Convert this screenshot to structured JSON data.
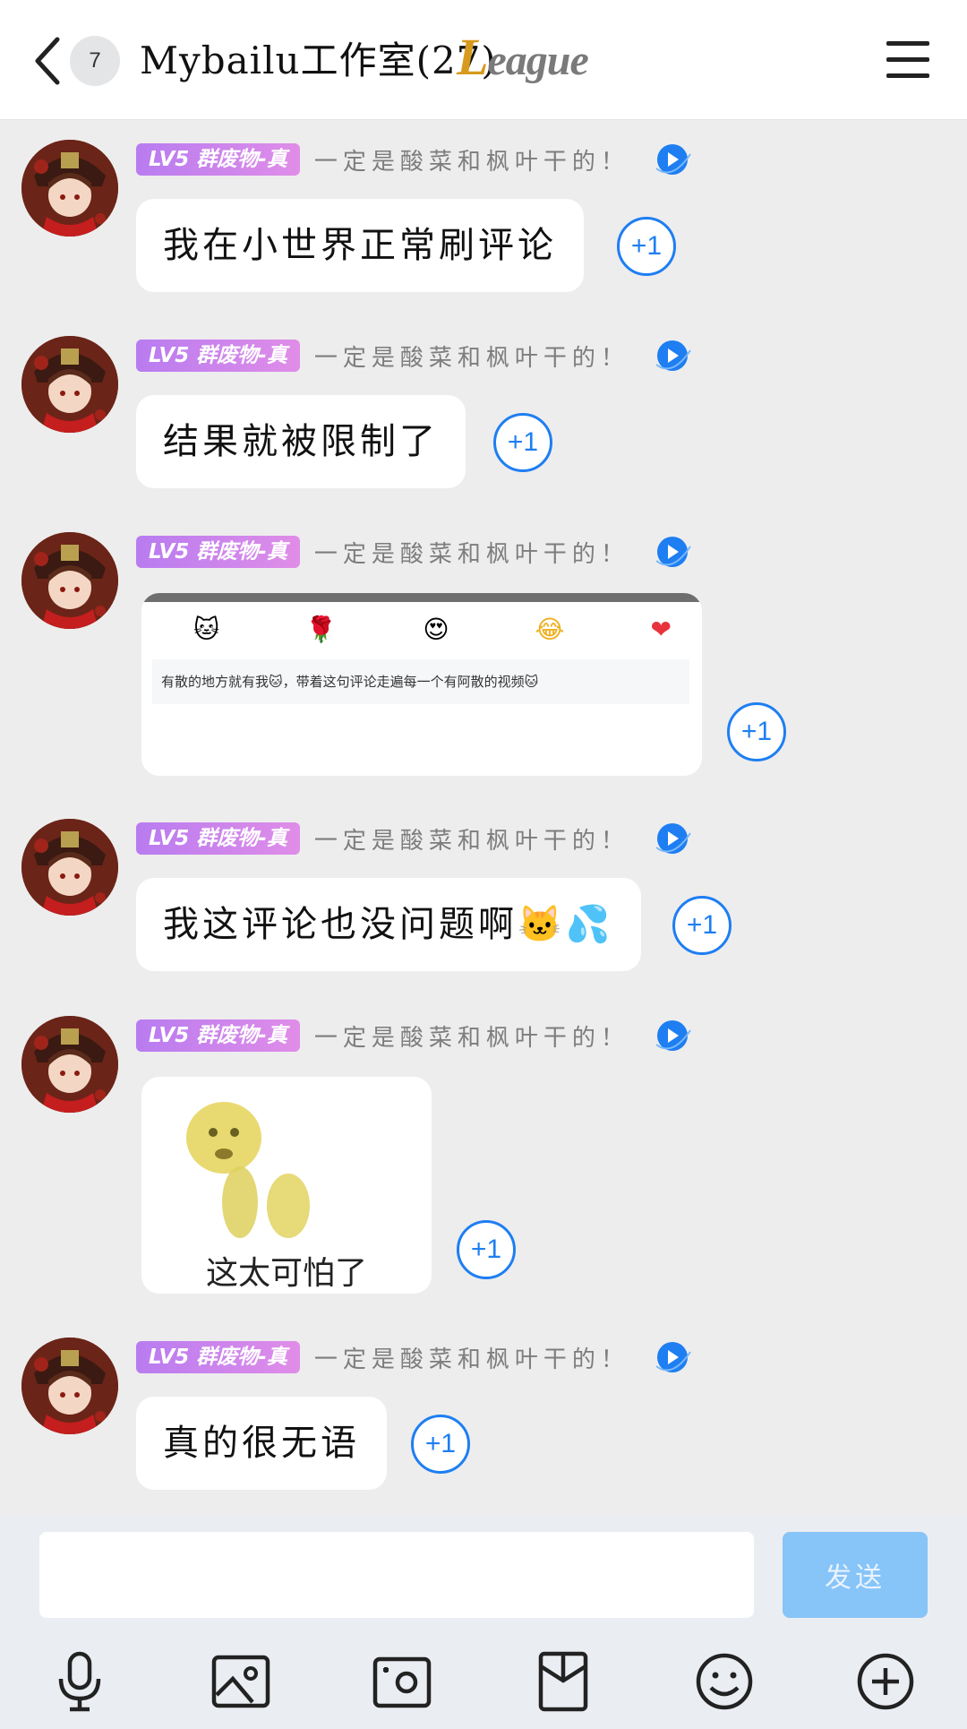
{
  "header": {
    "unread_count": "7",
    "title": "Mybailu工作室(27)",
    "league_logo_text": "League"
  },
  "sender": {
    "level_tag": "LV5 群废物-真",
    "nickname": "一定是酸菜和枫叶干的！"
  },
  "plus_one_label": "+1",
  "messages": [
    {
      "type": "text",
      "text": "我在小世界正常刷评论"
    },
    {
      "type": "text",
      "text": "结果就被限制了"
    },
    {
      "type": "image",
      "emoji_row": [
        "🐱",
        "🌹",
        "😍",
        "😂",
        "❤"
      ],
      "comment": "有散的地方就有我🐱，带着这句评论走遍每一个有阿散的视频🐱"
    },
    {
      "type": "text",
      "text": "我这评论也没问题啊🐱💦"
    },
    {
      "type": "sticker",
      "caption": "这太可怕了"
    },
    {
      "type": "text",
      "text": "真的很无语"
    }
  ],
  "input": {
    "placeholder": "",
    "send_label": "发送"
  },
  "toolbar": [
    "microphone-icon",
    "image-icon",
    "camera-icon",
    "red-packet-icon",
    "emoji-icon",
    "plus-icon"
  ],
  "colors": {
    "accent": "#1e7ef2",
    "tag_gradient_start": "#b87cf0",
    "tag_gradient_end": "#e08de8",
    "send_disabled": "#87c4f8"
  }
}
